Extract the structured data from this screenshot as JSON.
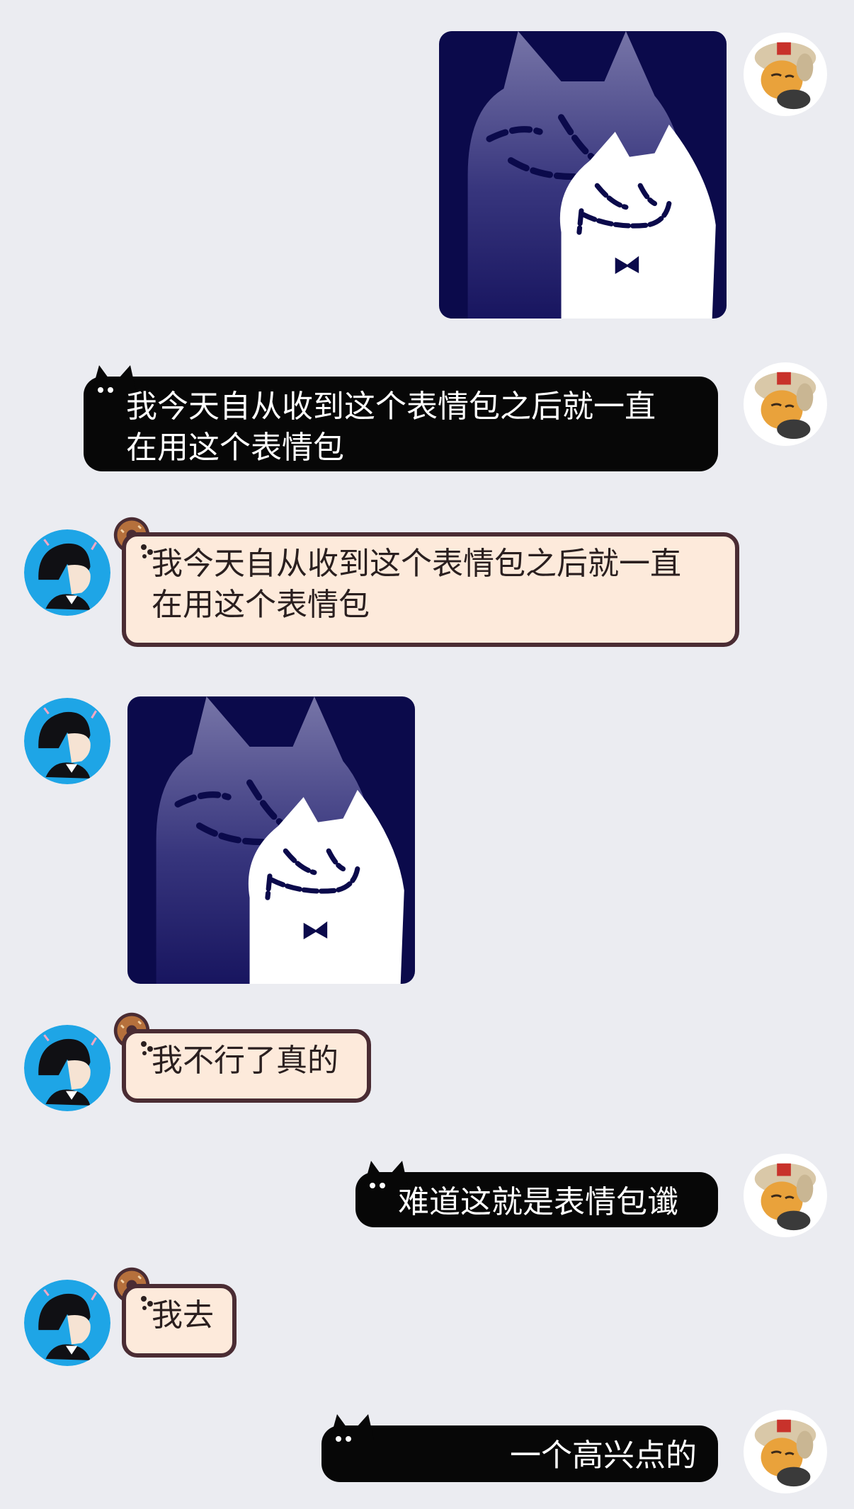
{
  "messages": [
    {
      "side": "right",
      "type": "sticker",
      "sticker": "smirking-cat-sticker"
    },
    {
      "side": "right",
      "type": "text",
      "lines": [
        "我今天自从收到这个表情包之后就一直",
        "在用这个表情包"
      ]
    },
    {
      "side": "left",
      "type": "text",
      "lines": [
        "我今天自从收到这个表情包之后就一直",
        "在用这个表情包"
      ]
    },
    {
      "side": "left",
      "type": "sticker",
      "sticker": "smirking-cat-sticker"
    },
    {
      "side": "left",
      "type": "text",
      "lines": [
        "我不行了真的"
      ]
    },
    {
      "side": "right",
      "type": "text",
      "lines": [
        "难道这就是表情包谶"
      ]
    },
    {
      "side": "left",
      "type": "text",
      "lines": [
        "我去"
      ]
    },
    {
      "side": "right",
      "type": "text",
      "lines": [
        "一个高兴点的"
      ]
    }
  ],
  "avatars": {
    "self": "cat-hat-avatar",
    "other": "anime-boy-avatar"
  },
  "colors": {
    "background": "#ebecf1",
    "self_bubble": "#070707",
    "other_bubble": "#fdeadb",
    "other_border": "#4a2c33",
    "sticker_bg": "#0d0b4a"
  }
}
